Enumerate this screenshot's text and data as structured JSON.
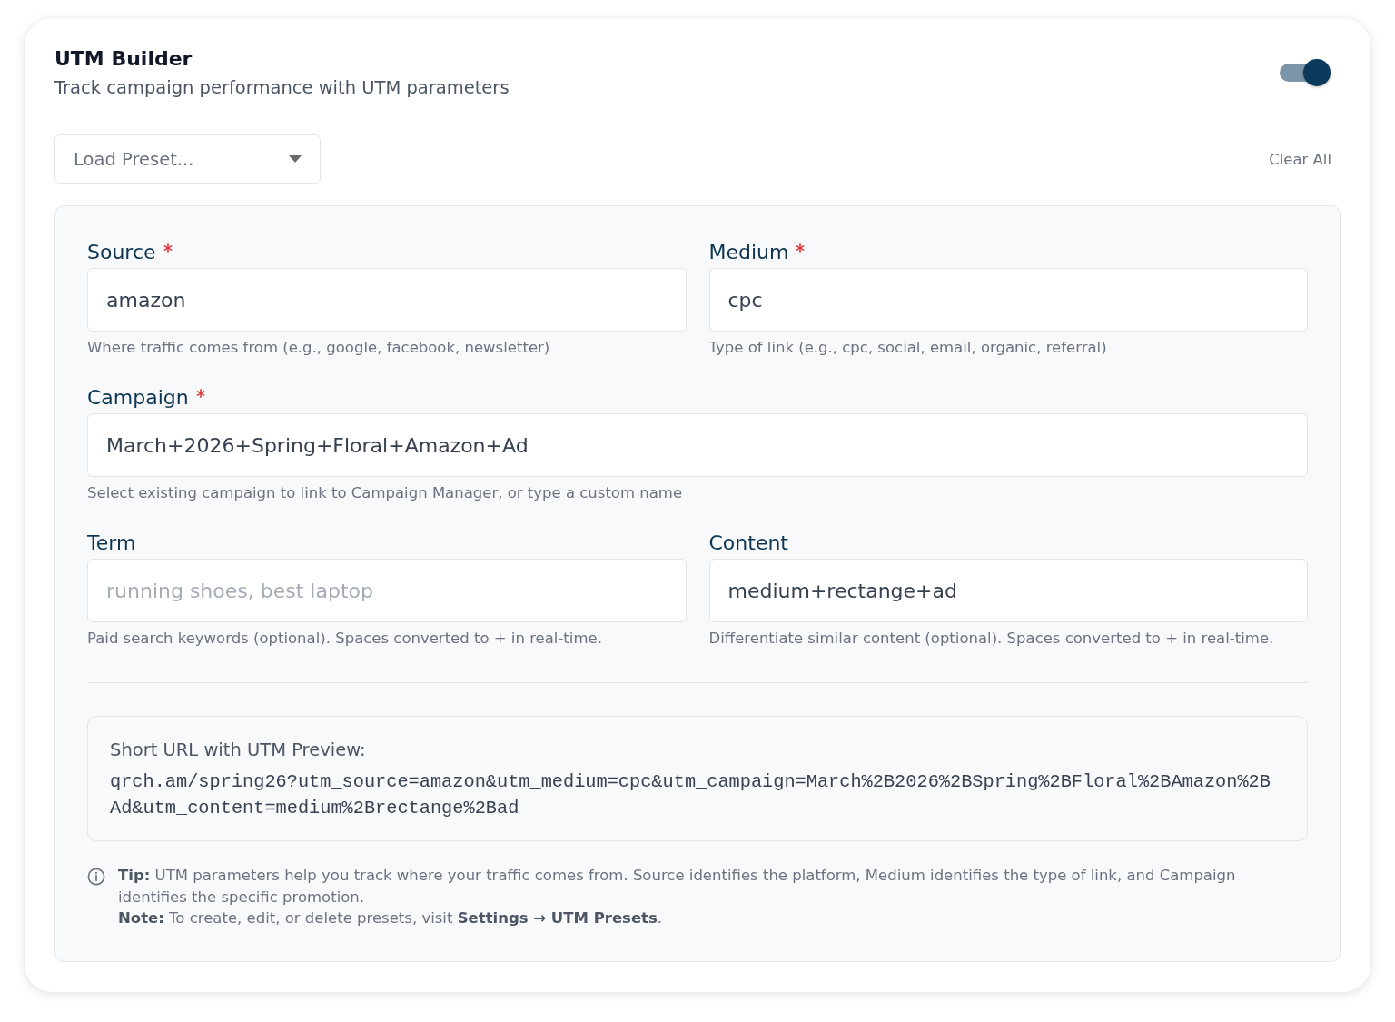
{
  "header": {
    "title": "UTM Builder",
    "subtitle": "Track campaign performance with UTM parameters",
    "toggle": {
      "on": true
    }
  },
  "toolbar": {
    "preset_dropdown": {
      "text": "Load Preset..."
    },
    "clear_button": "Clear All"
  },
  "field_rows": [
    {
      "fields": [
        {
          "label": "Source",
          "required": true,
          "value": "amazon",
          "hint": "Where traffic comes from (e.g., google, facebook, newsletter)"
        },
        {
          "label": "Medium",
          "required": true,
          "value": "cpc",
          "hint": "Type of link (e.g., cpc, social, email, organic, referral)"
        }
      ]
    },
    {
      "fields": [
        {
          "label": "Campaign",
          "required": true,
          "value": "March+2026+Spring+Floral+Amazon+Ad",
          "hint": "Select existing campaign to link to Campaign Manager, or type a custom name"
        }
      ]
    },
    {
      "fields": [
        {
          "label": "Term",
          "required": false,
          "placeholder": "running shoes, best laptop",
          "hint": "Paid search keywords (optional). Spaces converted to + in real-time."
        },
        {
          "label": "Content",
          "required": false,
          "value": "medium+rectange+ad",
          "hint": "Differentiate similar content (optional). Spaces converted to + in real-time."
        }
      ]
    }
  ],
  "preview": {
    "label": "Short URL with UTM Preview:",
    "url": "qrch.am/spring26?utm_source=amazon&utm_medium=cpc&utm_campaign=March%2B2026%2BSpring%2BFloral%2BAmazon%2BAd&utm_content=medium%2Brectange%2Bad"
  },
  "tip": {
    "tip": "**Tip:** UTM parameters help you track where your traffic comes from. Source identifies the platform, Medium identifies the type of link, and Campaign identifies the specific promotion.",
    "note": "**Note:** To create, edit, or delete presets, visit **Settings → UTM Presets**."
  }
}
